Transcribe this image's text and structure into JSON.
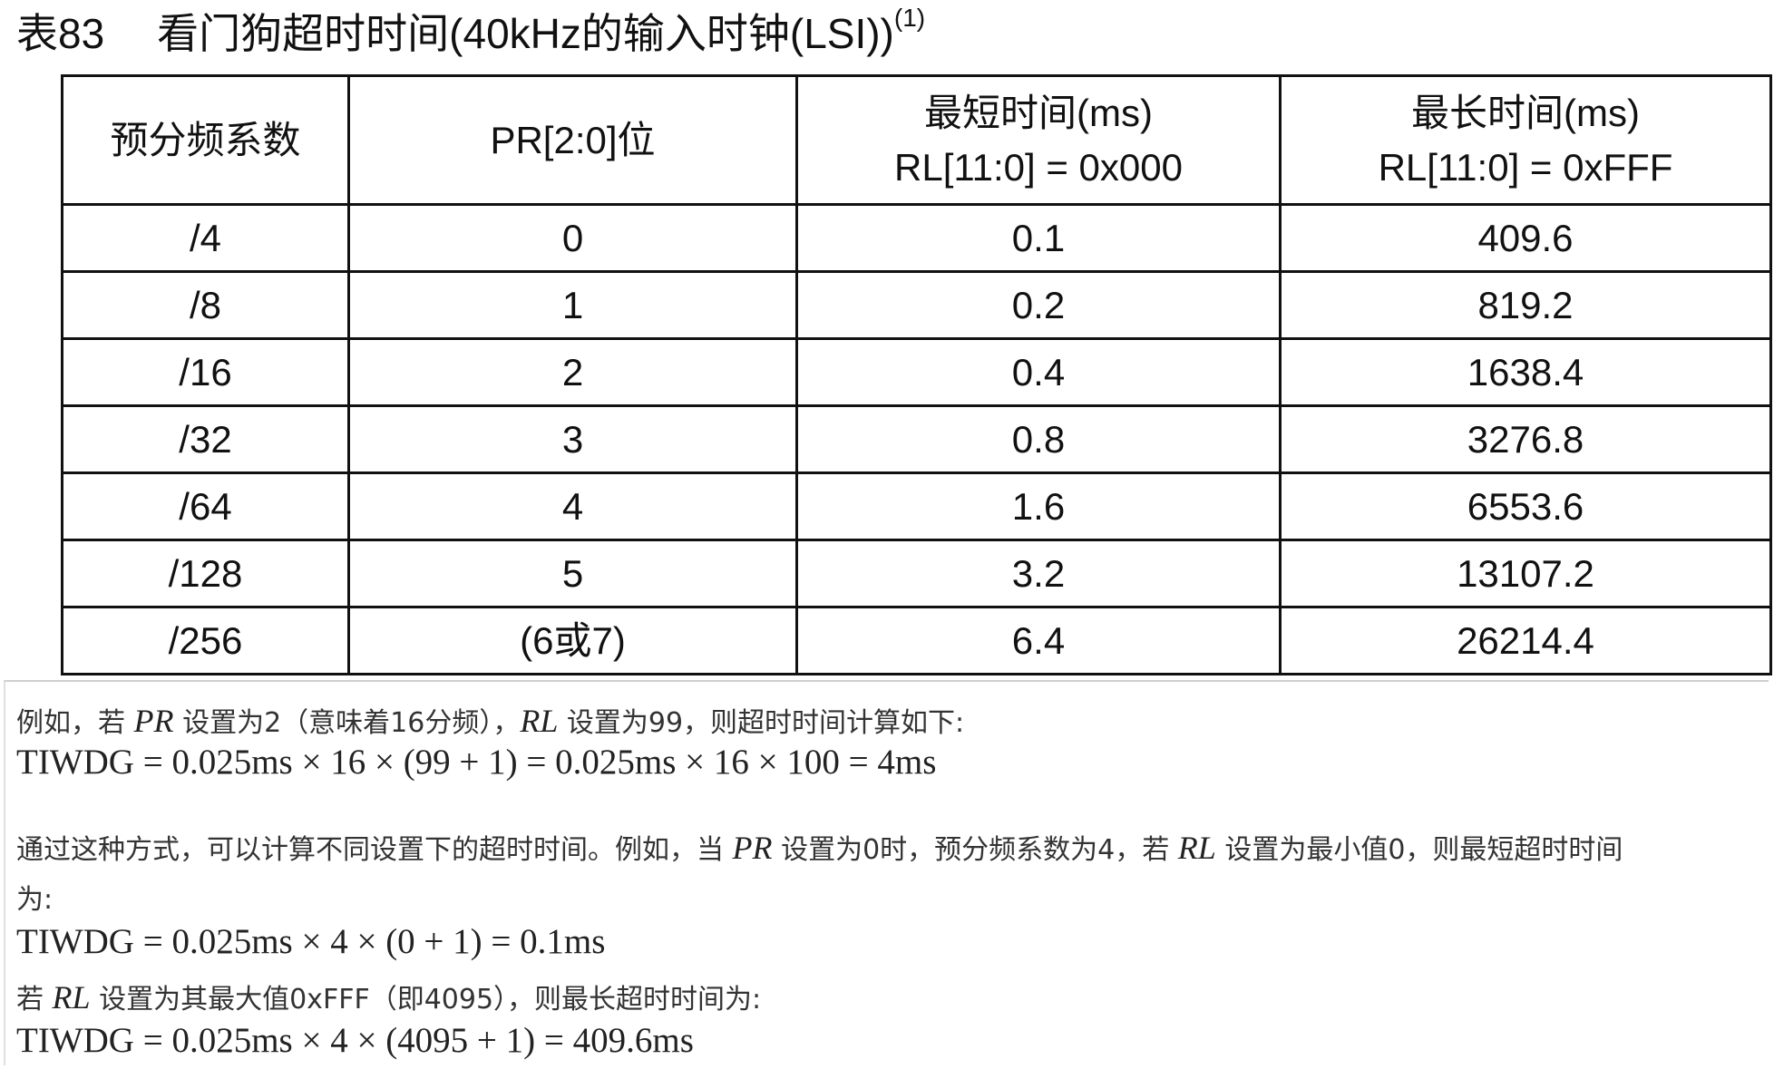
{
  "caption": {
    "number": "表83",
    "title": "看门狗超时时间(40kHz的输入时钟(LSI))",
    "footnote_mark": "(1)"
  },
  "table": {
    "headers": [
      {
        "line1": "预分频系数",
        "line2": ""
      },
      {
        "line1": "PR[2:0]位",
        "line2": ""
      },
      {
        "line1": "最短时间(ms)",
        "line2": "RL[11:0] = 0x000"
      },
      {
        "line1": "最长时间(ms)",
        "line2": "RL[11:0] = 0xFFF"
      }
    ],
    "rows": [
      [
        "/4",
        "0",
        "0.1",
        "409.6"
      ],
      [
        "/8",
        "1",
        "0.2",
        "819.2"
      ],
      [
        "/16",
        "2",
        "0.4",
        "1638.4"
      ],
      [
        "/32",
        "3",
        "0.8",
        "3276.8"
      ],
      [
        "/64",
        "4",
        "1.6",
        "6553.6"
      ],
      [
        "/128",
        "5",
        "3.2",
        "13107.2"
      ],
      [
        "/256",
        "(6或7)",
        "6.4",
        "26214.4"
      ]
    ]
  },
  "explanation": {
    "p1": {
      "t1": "例如，若 ",
      "v1": "PR",
      "t2": " 设置为2（意味着16分频），",
      "v2": "RL",
      "t3": " 设置为99，则超时时间计算如下:"
    },
    "formula1": "TIWDG = 0.025ms × 16 × (99 + 1) = 0.025ms × 16 × 100 = 4ms",
    "p2": {
      "t1": "通过这种方式，可以计算不同设置下的超时时间。例如，当 ",
      "v1": "PR",
      "t2": " 设置为0时，预分频系数为4，若 ",
      "v2": "RL",
      "t3": " 设置为最小值0，则最短超时时间"
    },
    "p2_cont": "为:",
    "formula2": "TIWDG = 0.025ms × 4 × (0 + 1) = 0.1ms",
    "p3": {
      "t1": "若 ",
      "v1": "RL",
      "t2": " 设置为其最大值0xFFF（即4095），则最长超时时间为:"
    },
    "formula3": "TIWDG = 0.025ms × 4 × (4095 + 1) = 409.6ms"
  }
}
